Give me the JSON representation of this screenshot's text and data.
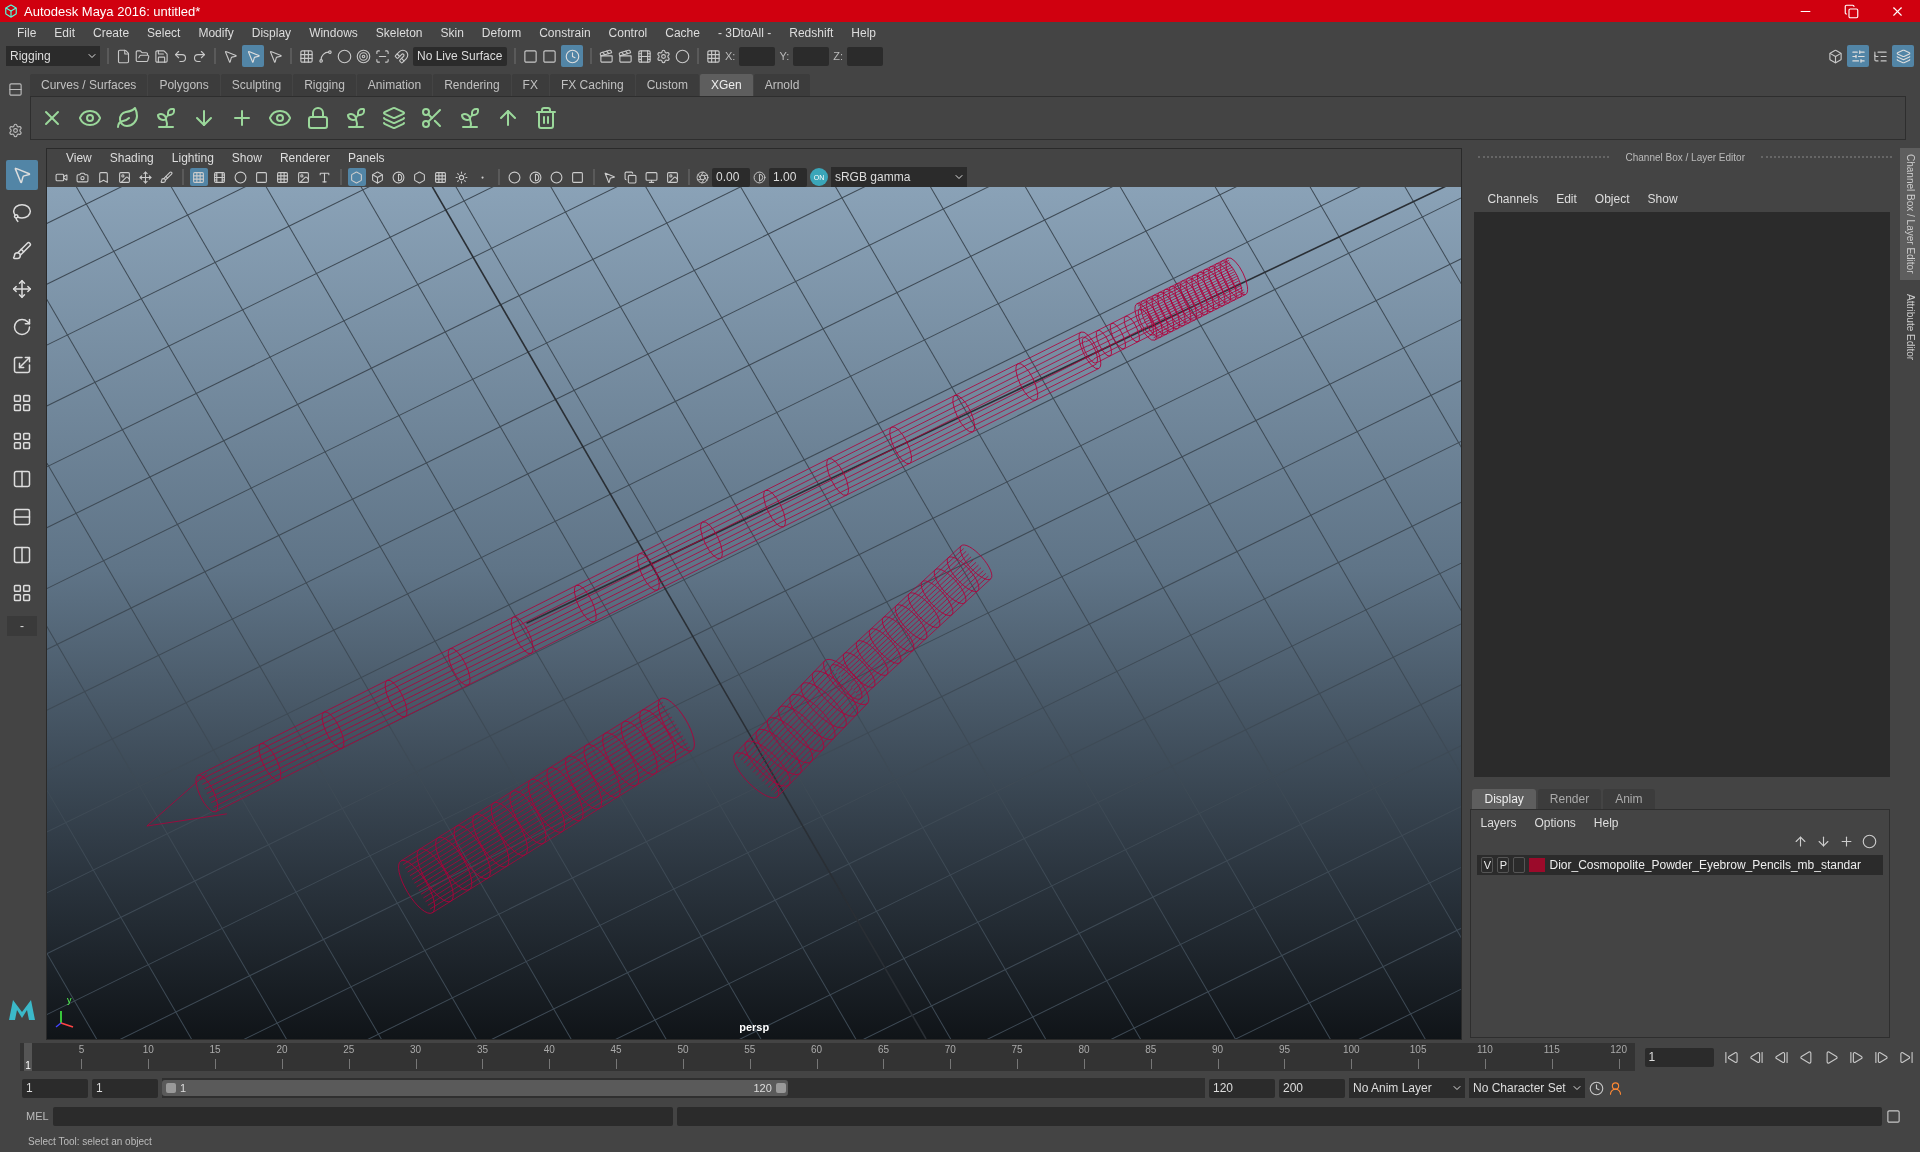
{
  "window": {
    "title": "Autodesk Maya 2016: untitled*"
  },
  "menu_bar": [
    "File",
    "Edit",
    "Create",
    "Select",
    "Modify",
    "Display",
    "Windows",
    "Skeleton",
    "Skin",
    "Deform",
    "Constrain",
    "Control",
    "Cache",
    "- 3DtoAll -",
    "Redshift",
    "Help"
  ],
  "status_line": {
    "mode": "Rigging",
    "live_surface": "No Live Surface",
    "coord_labels": [
      "X:",
      "Y:",
      "Z:"
    ]
  },
  "shelf": {
    "tabs": [
      {
        "label": "Curves / Surfaces",
        "selected": false
      },
      {
        "label": "Polygons",
        "selected": false
      },
      {
        "label": "Sculpting",
        "selected": false
      },
      {
        "label": "Rigging",
        "selected": false
      },
      {
        "label": "Animation",
        "selected": false
      },
      {
        "label": "Rendering",
        "selected": false
      },
      {
        "label": "FX",
        "selected": false
      },
      {
        "label": "FX Caching",
        "selected": false
      },
      {
        "label": "Custom",
        "selected": false
      },
      {
        "label": "XGen",
        "selected": true
      },
      {
        "label": "Arnold",
        "selected": false
      }
    ]
  },
  "toolbox": {
    "collapse_label": "-"
  },
  "viewport": {
    "menus": [
      "View",
      "Shading",
      "Lighting",
      "Show",
      "Renderer",
      "Panels"
    ],
    "exposure": "0.00",
    "gamma": "1.00",
    "color_management": "ON",
    "color_space": "sRGB gamma",
    "camera": "persp",
    "axis_label": "y"
  },
  "channel_box": {
    "title": "Channel Box / Layer Editor",
    "menus": [
      "Channels",
      "Edit",
      "Object",
      "Show"
    ]
  },
  "layer_editor": {
    "tabs": [
      {
        "label": "Display",
        "selected": true
      },
      {
        "label": "Render",
        "selected": false
      },
      {
        "label": "Anim",
        "selected": false
      }
    ],
    "menus": [
      "Layers",
      "Options",
      "Help"
    ],
    "layers": [
      {
        "visible": "V",
        "playback": "P",
        "color": "#9b0a2a",
        "name": "Dior_Cosmopolite_Powder_Eyebrow_Pencils_mb_standar"
      }
    ]
  },
  "side_tabs": [
    "Channel Box / Layer Editor",
    "Attribute Editor"
  ],
  "timeline": {
    "current": "1",
    "level": 0,
    "ticks": [
      "5",
      "10",
      "15",
      "20",
      "25",
      "30",
      "35",
      "40",
      "45",
      "50",
      "55",
      "60",
      "65",
      "70",
      "75",
      "80",
      "85",
      "90",
      "95",
      "100",
      "105",
      "110",
      "115",
      "120"
    ],
    "frame_field": "1"
  },
  "range": {
    "start": "1",
    "playback_start": "1",
    "level": 0.6,
    "slider_start": "1",
    "slider_end": "120",
    "playback_end": "120",
    "end": "200",
    "anim_layer": "No Anim Layer",
    "character_set": "No Character Set"
  },
  "command_line": {
    "label": "MEL"
  },
  "help_line": "Select Tool: select an object"
}
